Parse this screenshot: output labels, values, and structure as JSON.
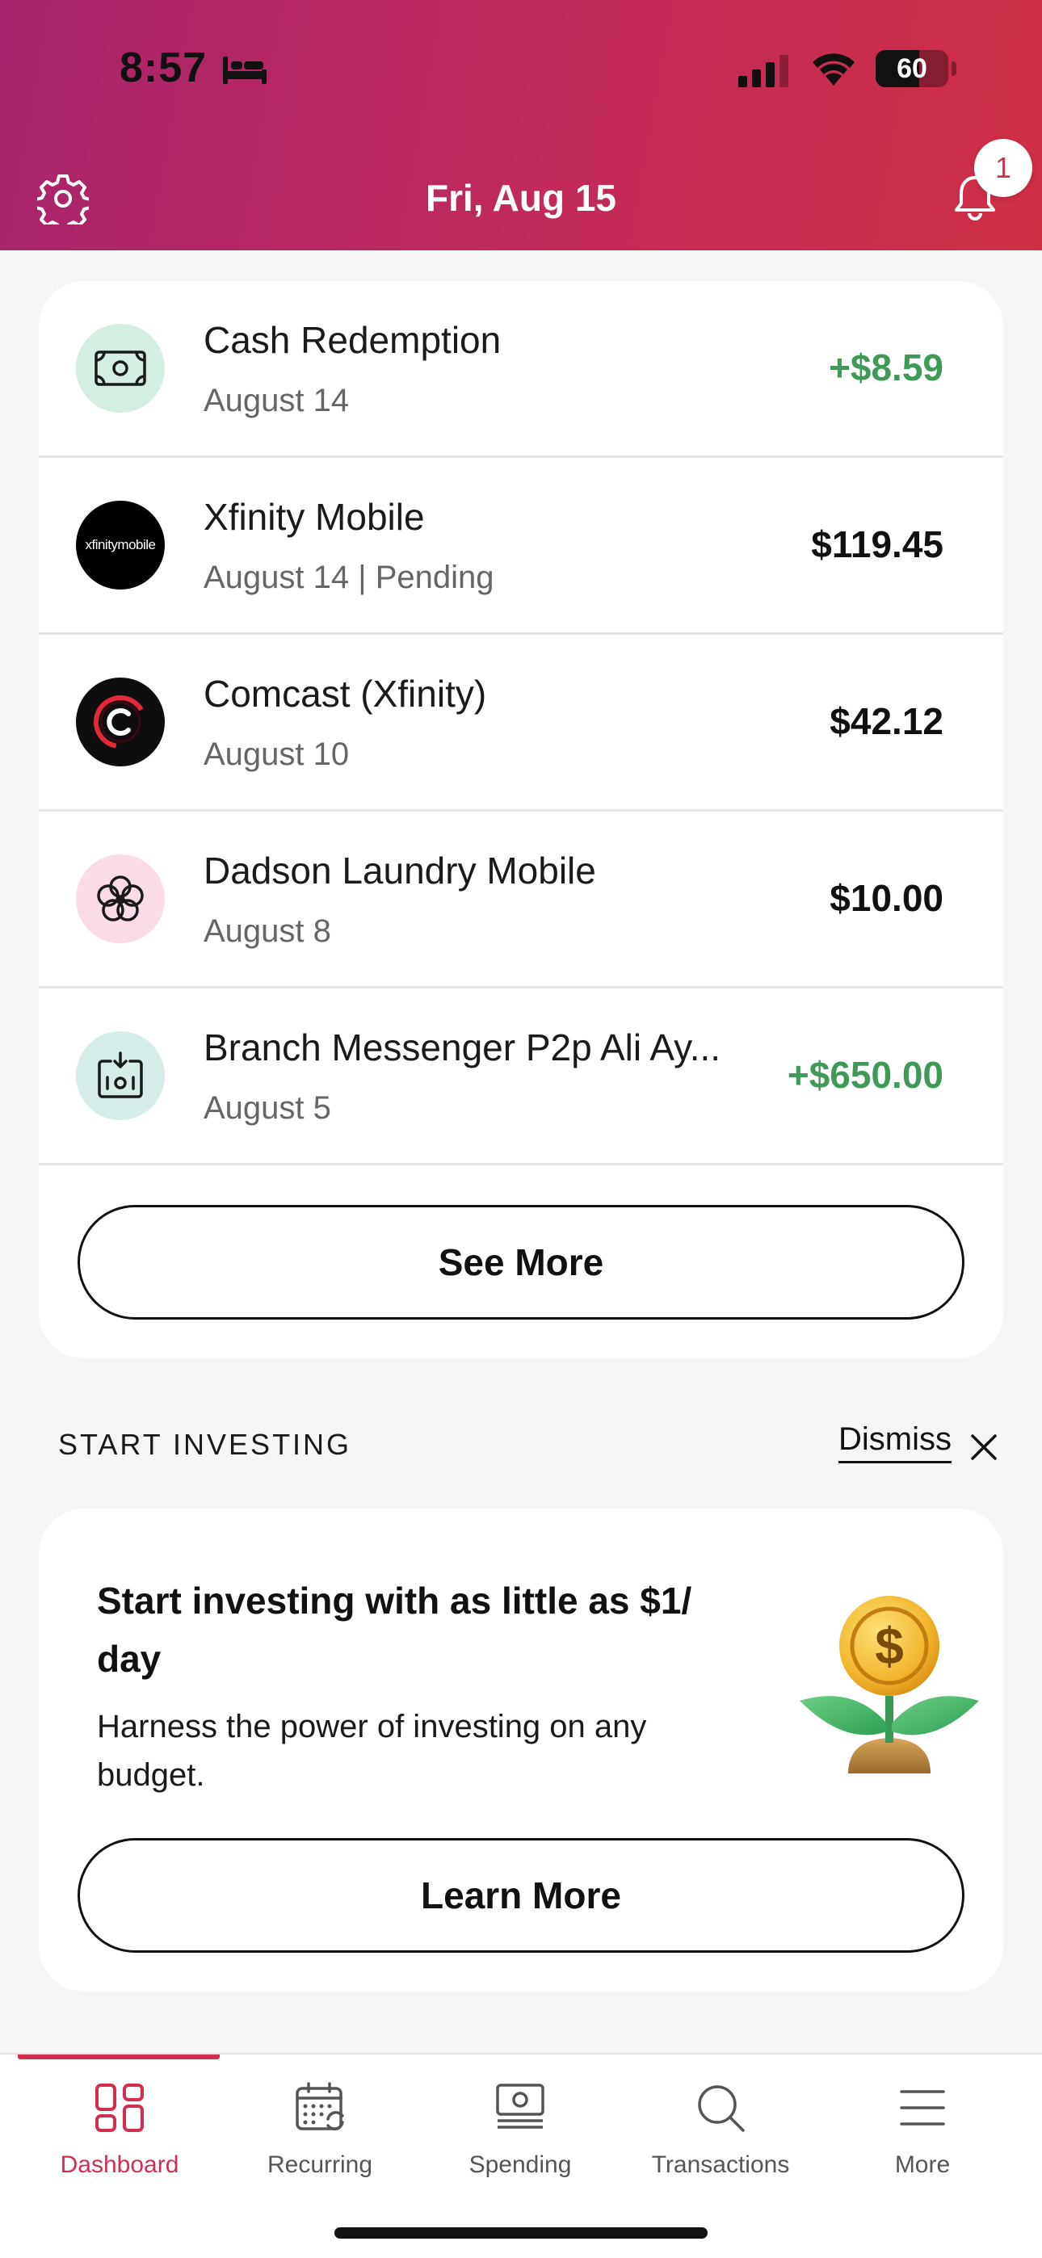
{
  "status_bar": {
    "time": "8:57",
    "battery_level": "60",
    "battery_fraction": 0.6
  },
  "header": {
    "title": "Fri, Aug 15",
    "notification_count": "1"
  },
  "colors": {
    "brand": "#d12f4f",
    "header_gradient_start": "#a6256c",
    "header_gradient_end": "#cf2e45",
    "credit": "#3f9a5a"
  },
  "transactions": {
    "items": [
      {
        "name": "Cash Redemption",
        "date": "August 14",
        "amount": "+$8.59",
        "type": "credit",
        "icon": "cash-icon"
      },
      {
        "name": "Xfinity Mobile",
        "date": "August 14 | Pending",
        "amount": "$119.45",
        "type": "debit",
        "icon": "xfinity-mobile-logo",
        "logo_text": "xfinitymobile"
      },
      {
        "name": "Comcast (Xfinity)",
        "date": "August 10",
        "amount": "$42.12",
        "type": "debit",
        "icon": "comcast-logo"
      },
      {
        "name": "Dadson Laundry Mobile",
        "date": "August 8",
        "amount": "$10.00",
        "type": "debit",
        "icon": "flower-icon"
      },
      {
        "name": "Branch Messenger P2p Ali Ay...",
        "date": "August 5",
        "amount": "+$650.00",
        "type": "credit",
        "icon": "deposit-icon"
      }
    ],
    "see_more_label": "See More"
  },
  "investing": {
    "section_label": "START INVESTING",
    "dismiss_label": "Dismiss",
    "title": "Start investing with as little as $1/ day",
    "body": "Harness the power of investing on any budget.",
    "learn_more_label": "Learn More",
    "illustration": "money-plant-icon"
  },
  "tab_bar": {
    "items": [
      {
        "label": "Dashboard",
        "icon": "dashboard-icon",
        "active": true
      },
      {
        "label": "Recurring",
        "icon": "calendar-icon",
        "active": false
      },
      {
        "label": "Spending",
        "icon": "spending-icon",
        "active": false
      },
      {
        "label": "Transactions",
        "icon": "search-icon",
        "active": false
      },
      {
        "label": "More",
        "icon": "menu-icon",
        "active": false
      }
    ]
  }
}
